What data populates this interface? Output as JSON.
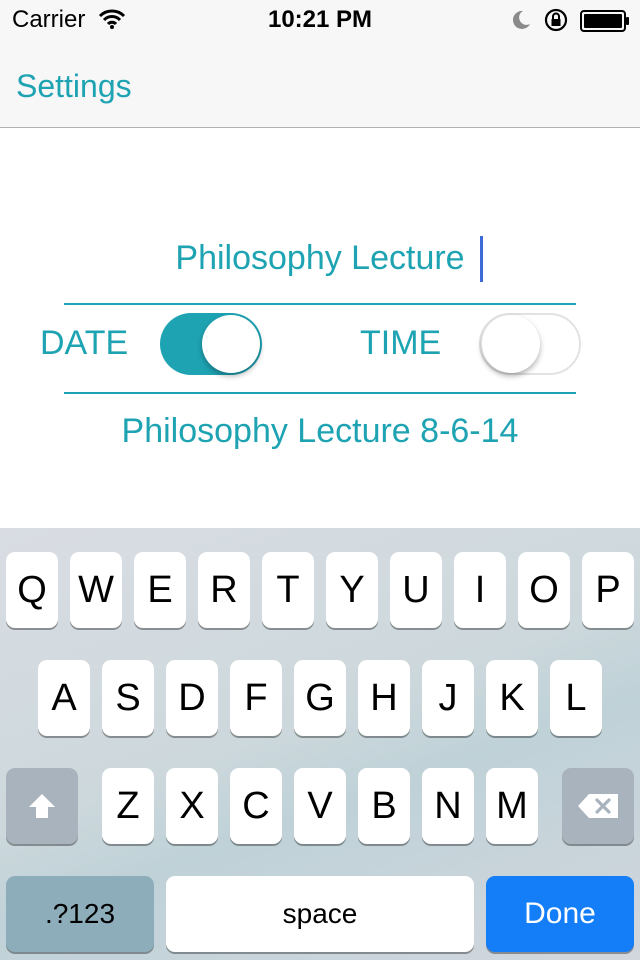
{
  "status_bar": {
    "carrier": "Carrier",
    "time": "10:21 PM",
    "icons": [
      "wifi-icon",
      "moon-icon",
      "rotation-lock-icon",
      "battery-icon"
    ]
  },
  "nav": {
    "back_label": "Settings"
  },
  "form": {
    "name_value": "Philosophy Lecture",
    "date_label": "DATE",
    "date_enabled": true,
    "time_label": "TIME",
    "time_enabled": false,
    "preview_text": "Philosophy Lecture 8-6-14"
  },
  "keyboard": {
    "row1": [
      "Q",
      "W",
      "E",
      "R",
      "T",
      "Y",
      "U",
      "I",
      "O",
      "P"
    ],
    "row2": [
      "A",
      "S",
      "D",
      "F",
      "G",
      "H",
      "J",
      "K",
      "L"
    ],
    "row3": [
      "Z",
      "X",
      "C",
      "V",
      "B",
      "N",
      "M"
    ],
    "shift_icon": "shift-icon",
    "delete_icon": "delete-icon",
    "numbers_label": ".?123",
    "space_label": "space",
    "done_label": "Done"
  },
  "colors": {
    "accent": "#1ea3b3",
    "done_button": "#137ef7",
    "caret": "#3d6bd9"
  }
}
